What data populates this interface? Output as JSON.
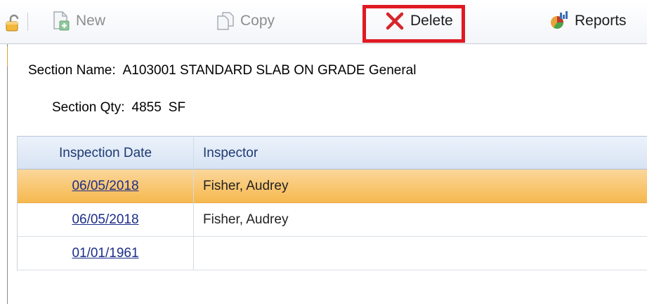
{
  "toolbar": {
    "lock_icon": "lock-icon",
    "new": {
      "label": "New",
      "icon": "new-document-icon",
      "enabled": false
    },
    "copy": {
      "label": "Copy",
      "icon": "copy-icon",
      "enabled": false
    },
    "delete": {
      "label": "Delete",
      "icon": "delete-x-icon",
      "enabled": true,
      "highlighted": true
    },
    "reports": {
      "label": "Reports",
      "icon": "reports-icon",
      "enabled": true
    }
  },
  "section": {
    "name_label": "Section Name:",
    "name_value": "A103001 STANDARD SLAB ON GRADE General",
    "qty_label": "Section Qty:",
    "qty_value": "4855",
    "qty_unit": "SF"
  },
  "grid": {
    "columns": [
      "Inspection Date",
      "Inspector"
    ],
    "rows": [
      {
        "date": "06/05/2018",
        "inspector": "Fisher, Audrey",
        "selected": true
      },
      {
        "date": "06/05/2018",
        "inspector": "Fisher, Audrey",
        "selected": false
      },
      {
        "date": "01/01/1961",
        "inspector": "",
        "selected": false
      }
    ]
  },
  "colors": {
    "highlight_border": "#e01922",
    "selected_row": "#f6b84f",
    "link": "#1c2d8a",
    "header_text": "#1e3a73",
    "delete_x": "#d8252b"
  }
}
